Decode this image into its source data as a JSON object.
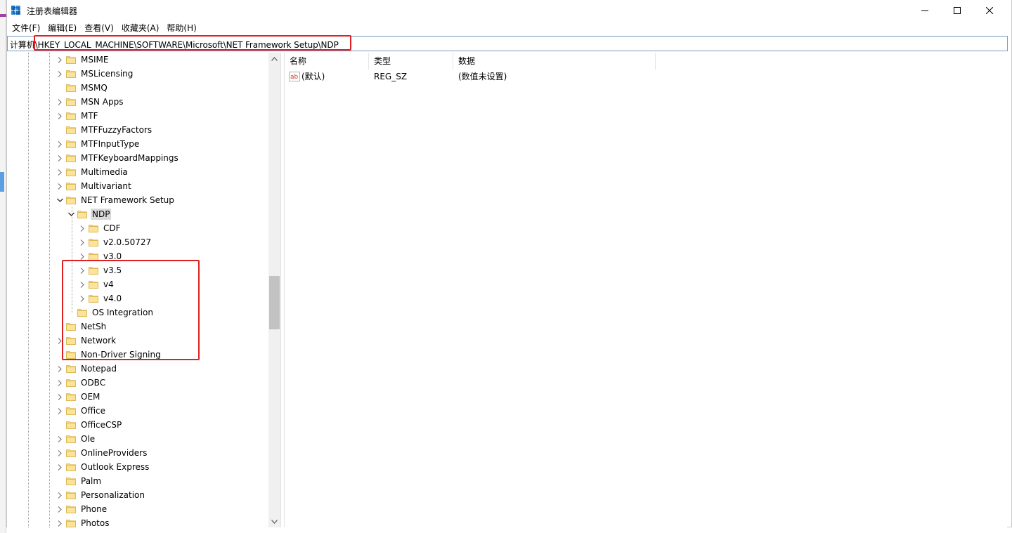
{
  "window": {
    "title": "注册表编辑器"
  },
  "menu": [
    "文件(F)",
    "编辑(E)",
    "查看(V)",
    "收藏夹(A)",
    "帮助(H)"
  ],
  "address": {
    "path": "计算机\\HKEY_LOCAL_MACHINE\\SOFTWARE\\Microsoft\\NET Framework Setup\\NDP"
  },
  "tree": {
    "items": [
      {
        "label": "MSIME",
        "level": 0,
        "expander": "collapsed"
      },
      {
        "label": "MSLicensing",
        "level": 0,
        "expander": "collapsed"
      },
      {
        "label": "MSMQ",
        "level": 0,
        "expander": "none"
      },
      {
        "label": "MSN Apps",
        "level": 0,
        "expander": "collapsed"
      },
      {
        "label": "MTF",
        "level": 0,
        "expander": "collapsed"
      },
      {
        "label": "MTFFuzzyFactors",
        "level": 0,
        "expander": "none"
      },
      {
        "label": "MTFInputType",
        "level": 0,
        "expander": "collapsed"
      },
      {
        "label": "MTFKeyboardMappings",
        "level": 0,
        "expander": "collapsed"
      },
      {
        "label": "Multimedia",
        "level": 0,
        "expander": "collapsed"
      },
      {
        "label": "Multivariant",
        "level": 0,
        "expander": "collapsed"
      },
      {
        "label": "NET Framework Setup",
        "level": 0,
        "expander": "expanded"
      },
      {
        "label": "NDP",
        "level": 1,
        "expander": "expanded",
        "selected": true
      },
      {
        "label": "CDF",
        "level": 2,
        "expander": "collapsed"
      },
      {
        "label": "v2.0.50727",
        "level": 2,
        "expander": "collapsed"
      },
      {
        "label": "v3.0",
        "level": 2,
        "expander": "collapsed"
      },
      {
        "label": "v3.5",
        "level": 2,
        "expander": "collapsed"
      },
      {
        "label": "v4",
        "level": 2,
        "expander": "collapsed"
      },
      {
        "label": "v4.0",
        "level": 2,
        "expander": "collapsed"
      },
      {
        "label": "OS Integration",
        "level": 1,
        "expander": "none"
      },
      {
        "label": "NetSh",
        "level": 0,
        "expander": "none"
      },
      {
        "label": "Network",
        "level": 0,
        "expander": "collapsed"
      },
      {
        "label": "Non-Driver Signing",
        "level": 0,
        "expander": "none"
      },
      {
        "label": "Notepad",
        "level": 0,
        "expander": "collapsed"
      },
      {
        "label": "ODBC",
        "level": 0,
        "expander": "collapsed"
      },
      {
        "label": "OEM",
        "level": 0,
        "expander": "collapsed"
      },
      {
        "label": "Office",
        "level": 0,
        "expander": "collapsed"
      },
      {
        "label": "OfficeCSP",
        "level": 0,
        "expander": "none"
      },
      {
        "label": "Ole",
        "level": 0,
        "expander": "collapsed"
      },
      {
        "label": "OnlineProviders",
        "level": 0,
        "expander": "collapsed"
      },
      {
        "label": "Outlook Express",
        "level": 0,
        "expander": "collapsed"
      },
      {
        "label": "Palm",
        "level": 0,
        "expander": "none"
      },
      {
        "label": "Personalization",
        "level": 0,
        "expander": "collapsed"
      },
      {
        "label": "Phone",
        "level": 0,
        "expander": "collapsed"
      },
      {
        "label": "Photos",
        "level": 0,
        "expander": "collapsed"
      }
    ]
  },
  "list": {
    "columns": {
      "name": "名称",
      "type": "类型",
      "data": "数据"
    },
    "rows": [
      {
        "name": "(默认)",
        "type": "REG_SZ",
        "data": "(数值未设置)",
        "icon": "string-value-icon"
      }
    ]
  },
  "colors": {
    "highlight": "#e02020",
    "folder": "#f8d775",
    "selection": "#d9d9d9"
  }
}
